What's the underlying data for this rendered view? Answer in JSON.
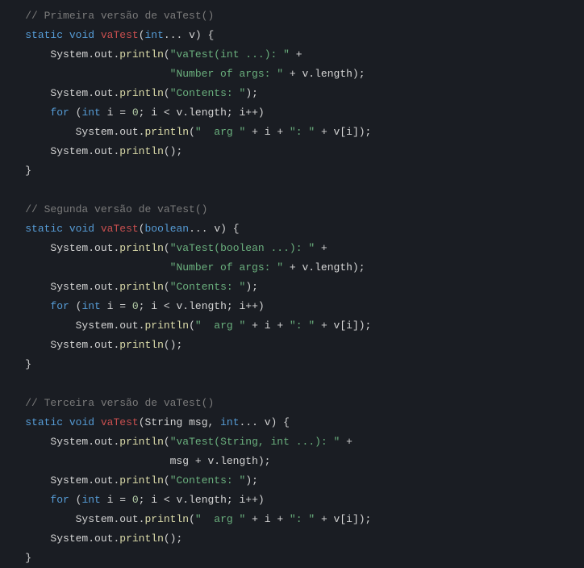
{
  "tokens": [
    {
      "t": "    ",
      "c": ""
    },
    {
      "t": "// Primeira versão de vaTest()",
      "c": "c-comment"
    },
    {
      "t": "\n",
      "c": ""
    },
    {
      "t": "    ",
      "c": ""
    },
    {
      "t": "static",
      "c": "c-keyword"
    },
    {
      "t": " ",
      "c": ""
    },
    {
      "t": "void",
      "c": "c-type"
    },
    {
      "t": " ",
      "c": ""
    },
    {
      "t": "vaTest",
      "c": "c-methoddef"
    },
    {
      "t": "(",
      "c": "c-punct"
    },
    {
      "t": "int",
      "c": "c-type"
    },
    {
      "t": "... v) {",
      "c": "c-punct"
    },
    {
      "t": "\n",
      "c": ""
    },
    {
      "t": "        ",
      "c": ""
    },
    {
      "t": "System",
      "c": "c-ident"
    },
    {
      "t": ".",
      "c": "c-dot"
    },
    {
      "t": "out",
      "c": "c-ident"
    },
    {
      "t": ".",
      "c": "c-dot"
    },
    {
      "t": "println",
      "c": "c-method"
    },
    {
      "t": "(",
      "c": "c-punct"
    },
    {
      "t": "\"vaTest(int ...): \"",
      "c": "c-string"
    },
    {
      "t": " + ",
      "c": "c-punct"
    },
    {
      "t": "\n",
      "c": ""
    },
    {
      "t": "                           ",
      "c": ""
    },
    {
      "t": "\"Number of args: \"",
      "c": "c-string"
    },
    {
      "t": " + v",
      "c": "c-punct"
    },
    {
      "t": ".",
      "c": "c-dot"
    },
    {
      "t": "length",
      "c": "c-ident"
    },
    {
      "t": ");",
      "c": "c-punct"
    },
    {
      "t": "\n",
      "c": ""
    },
    {
      "t": "        ",
      "c": ""
    },
    {
      "t": "System",
      "c": "c-ident"
    },
    {
      "t": ".",
      "c": "c-dot"
    },
    {
      "t": "out",
      "c": "c-ident"
    },
    {
      "t": ".",
      "c": "c-dot"
    },
    {
      "t": "println",
      "c": "c-method"
    },
    {
      "t": "(",
      "c": "c-punct"
    },
    {
      "t": "\"Contents: \"",
      "c": "c-string"
    },
    {
      "t": ");",
      "c": "c-punct"
    },
    {
      "t": "\n",
      "c": ""
    },
    {
      "t": "        ",
      "c": ""
    },
    {
      "t": "for",
      "c": "c-keyword"
    },
    {
      "t": " (",
      "c": "c-punct"
    },
    {
      "t": "int",
      "c": "c-type"
    },
    {
      "t": " i = ",
      "c": "c-punct"
    },
    {
      "t": "0",
      "c": "c-number"
    },
    {
      "t": "; i < v",
      "c": "c-punct"
    },
    {
      "t": ".",
      "c": "c-dot"
    },
    {
      "t": "length",
      "c": "c-ident"
    },
    {
      "t": "; i++)",
      "c": "c-punct"
    },
    {
      "t": "\n",
      "c": ""
    },
    {
      "t": "            ",
      "c": ""
    },
    {
      "t": "System",
      "c": "c-ident"
    },
    {
      "t": ".",
      "c": "c-dot"
    },
    {
      "t": "out",
      "c": "c-ident"
    },
    {
      "t": ".",
      "c": "c-dot"
    },
    {
      "t": "println",
      "c": "c-method"
    },
    {
      "t": "(",
      "c": "c-punct"
    },
    {
      "t": "\"  arg \"",
      "c": "c-string"
    },
    {
      "t": " + i + ",
      "c": "c-punct"
    },
    {
      "t": "\": \"",
      "c": "c-string"
    },
    {
      "t": " + v[i]);",
      "c": "c-punct"
    },
    {
      "t": "\n",
      "c": ""
    },
    {
      "t": "        ",
      "c": ""
    },
    {
      "t": "System",
      "c": "c-ident"
    },
    {
      "t": ".",
      "c": "c-dot"
    },
    {
      "t": "out",
      "c": "c-ident"
    },
    {
      "t": ".",
      "c": "c-dot"
    },
    {
      "t": "println",
      "c": "c-method"
    },
    {
      "t": "();",
      "c": "c-punct"
    },
    {
      "t": "\n",
      "c": ""
    },
    {
      "t": "    }",
      "c": "c-punct"
    },
    {
      "t": "\n",
      "c": ""
    },
    {
      "t": "\n",
      "c": ""
    },
    {
      "t": "    ",
      "c": ""
    },
    {
      "t": "// Segunda versão de vaTest()",
      "c": "c-comment"
    },
    {
      "t": "\n",
      "c": ""
    },
    {
      "t": "    ",
      "c": ""
    },
    {
      "t": "static",
      "c": "c-keyword"
    },
    {
      "t": " ",
      "c": ""
    },
    {
      "t": "void",
      "c": "c-type"
    },
    {
      "t": " ",
      "c": ""
    },
    {
      "t": "vaTest",
      "c": "c-methoddef"
    },
    {
      "t": "(",
      "c": "c-punct"
    },
    {
      "t": "boolean",
      "c": "c-type"
    },
    {
      "t": "... v) {",
      "c": "c-punct"
    },
    {
      "t": "\n",
      "c": ""
    },
    {
      "t": "        ",
      "c": ""
    },
    {
      "t": "System",
      "c": "c-ident"
    },
    {
      "t": ".",
      "c": "c-dot"
    },
    {
      "t": "out",
      "c": "c-ident"
    },
    {
      "t": ".",
      "c": "c-dot"
    },
    {
      "t": "println",
      "c": "c-method"
    },
    {
      "t": "(",
      "c": "c-punct"
    },
    {
      "t": "\"vaTest(boolean ...): \"",
      "c": "c-string"
    },
    {
      "t": " + ",
      "c": "c-punct"
    },
    {
      "t": "\n",
      "c": ""
    },
    {
      "t": "                           ",
      "c": ""
    },
    {
      "t": "\"Number of args: \"",
      "c": "c-string"
    },
    {
      "t": " + v",
      "c": "c-punct"
    },
    {
      "t": ".",
      "c": "c-dot"
    },
    {
      "t": "length",
      "c": "c-ident"
    },
    {
      "t": ");",
      "c": "c-punct"
    },
    {
      "t": "\n",
      "c": ""
    },
    {
      "t": "        ",
      "c": ""
    },
    {
      "t": "System",
      "c": "c-ident"
    },
    {
      "t": ".",
      "c": "c-dot"
    },
    {
      "t": "out",
      "c": "c-ident"
    },
    {
      "t": ".",
      "c": "c-dot"
    },
    {
      "t": "println",
      "c": "c-method"
    },
    {
      "t": "(",
      "c": "c-punct"
    },
    {
      "t": "\"Contents: \"",
      "c": "c-string"
    },
    {
      "t": ");",
      "c": "c-punct"
    },
    {
      "t": "\n",
      "c": ""
    },
    {
      "t": "        ",
      "c": ""
    },
    {
      "t": "for",
      "c": "c-keyword"
    },
    {
      "t": " (",
      "c": "c-punct"
    },
    {
      "t": "int",
      "c": "c-type"
    },
    {
      "t": " i = ",
      "c": "c-punct"
    },
    {
      "t": "0",
      "c": "c-number"
    },
    {
      "t": "; i < v",
      "c": "c-punct"
    },
    {
      "t": ".",
      "c": "c-dot"
    },
    {
      "t": "length",
      "c": "c-ident"
    },
    {
      "t": "; i++)",
      "c": "c-punct"
    },
    {
      "t": "\n",
      "c": ""
    },
    {
      "t": "            ",
      "c": ""
    },
    {
      "t": "System",
      "c": "c-ident"
    },
    {
      "t": ".",
      "c": "c-dot"
    },
    {
      "t": "out",
      "c": "c-ident"
    },
    {
      "t": ".",
      "c": "c-dot"
    },
    {
      "t": "println",
      "c": "c-method"
    },
    {
      "t": "(",
      "c": "c-punct"
    },
    {
      "t": "\"  arg \"",
      "c": "c-string"
    },
    {
      "t": " + i + ",
      "c": "c-punct"
    },
    {
      "t": "\": \"",
      "c": "c-string"
    },
    {
      "t": " + v[i]);",
      "c": "c-punct"
    },
    {
      "t": "\n",
      "c": ""
    },
    {
      "t": "        ",
      "c": ""
    },
    {
      "t": "System",
      "c": "c-ident"
    },
    {
      "t": ".",
      "c": "c-dot"
    },
    {
      "t": "out",
      "c": "c-ident"
    },
    {
      "t": ".",
      "c": "c-dot"
    },
    {
      "t": "println",
      "c": "c-method"
    },
    {
      "t": "();",
      "c": "c-punct"
    },
    {
      "t": "\n",
      "c": ""
    },
    {
      "t": "    }",
      "c": "c-punct"
    },
    {
      "t": "\n",
      "c": ""
    },
    {
      "t": "\n",
      "c": ""
    },
    {
      "t": "    ",
      "c": ""
    },
    {
      "t": "// Terceira versão de vaTest()",
      "c": "c-comment"
    },
    {
      "t": "\n",
      "c": ""
    },
    {
      "t": "    ",
      "c": ""
    },
    {
      "t": "static",
      "c": "c-keyword"
    },
    {
      "t": " ",
      "c": ""
    },
    {
      "t": "void",
      "c": "c-type"
    },
    {
      "t": " ",
      "c": ""
    },
    {
      "t": "vaTest",
      "c": "c-methoddef"
    },
    {
      "t": "(",
      "c": "c-punct"
    },
    {
      "t": "String msg, ",
      "c": "c-ident"
    },
    {
      "t": "int",
      "c": "c-type"
    },
    {
      "t": "... v) {",
      "c": "c-punct"
    },
    {
      "t": "\n",
      "c": ""
    },
    {
      "t": "        ",
      "c": ""
    },
    {
      "t": "System",
      "c": "c-ident"
    },
    {
      "t": ".",
      "c": "c-dot"
    },
    {
      "t": "out",
      "c": "c-ident"
    },
    {
      "t": ".",
      "c": "c-dot"
    },
    {
      "t": "println",
      "c": "c-method"
    },
    {
      "t": "(",
      "c": "c-punct"
    },
    {
      "t": "\"vaTest(String, int ...): \"",
      "c": "c-string"
    },
    {
      "t": " + ",
      "c": "c-punct"
    },
    {
      "t": "\n",
      "c": ""
    },
    {
      "t": "                           msg + v",
      "c": "c-punct"
    },
    {
      "t": ".",
      "c": "c-dot"
    },
    {
      "t": "length",
      "c": "c-ident"
    },
    {
      "t": ");",
      "c": "c-punct"
    },
    {
      "t": "\n",
      "c": ""
    },
    {
      "t": "        ",
      "c": ""
    },
    {
      "t": "System",
      "c": "c-ident"
    },
    {
      "t": ".",
      "c": "c-dot"
    },
    {
      "t": "out",
      "c": "c-ident"
    },
    {
      "t": ".",
      "c": "c-dot"
    },
    {
      "t": "println",
      "c": "c-method"
    },
    {
      "t": "(",
      "c": "c-punct"
    },
    {
      "t": "\"Contents: \"",
      "c": "c-string"
    },
    {
      "t": ");",
      "c": "c-punct"
    },
    {
      "t": "\n",
      "c": ""
    },
    {
      "t": "        ",
      "c": ""
    },
    {
      "t": "for",
      "c": "c-keyword"
    },
    {
      "t": " (",
      "c": "c-punct"
    },
    {
      "t": "int",
      "c": "c-type"
    },
    {
      "t": " i = ",
      "c": "c-punct"
    },
    {
      "t": "0",
      "c": "c-number"
    },
    {
      "t": "; i < v",
      "c": "c-punct"
    },
    {
      "t": ".",
      "c": "c-dot"
    },
    {
      "t": "length",
      "c": "c-ident"
    },
    {
      "t": "; i++)",
      "c": "c-punct"
    },
    {
      "t": "\n",
      "c": ""
    },
    {
      "t": "            ",
      "c": ""
    },
    {
      "t": "System",
      "c": "c-ident"
    },
    {
      "t": ".",
      "c": "c-dot"
    },
    {
      "t": "out",
      "c": "c-ident"
    },
    {
      "t": ".",
      "c": "c-dot"
    },
    {
      "t": "println",
      "c": "c-method"
    },
    {
      "t": "(",
      "c": "c-punct"
    },
    {
      "t": "\"  arg \"",
      "c": "c-string"
    },
    {
      "t": " + i + ",
      "c": "c-punct"
    },
    {
      "t": "\": \"",
      "c": "c-string"
    },
    {
      "t": " + v[i]);",
      "c": "c-punct"
    },
    {
      "t": "\n",
      "c": ""
    },
    {
      "t": "        ",
      "c": ""
    },
    {
      "t": "System",
      "c": "c-ident"
    },
    {
      "t": ".",
      "c": "c-dot"
    },
    {
      "t": "out",
      "c": "c-ident"
    },
    {
      "t": ".",
      "c": "c-dot"
    },
    {
      "t": "println",
      "c": "c-method"
    },
    {
      "t": "();",
      "c": "c-punct"
    },
    {
      "t": "\n",
      "c": ""
    },
    {
      "t": "    }",
      "c": "c-punct"
    }
  ]
}
